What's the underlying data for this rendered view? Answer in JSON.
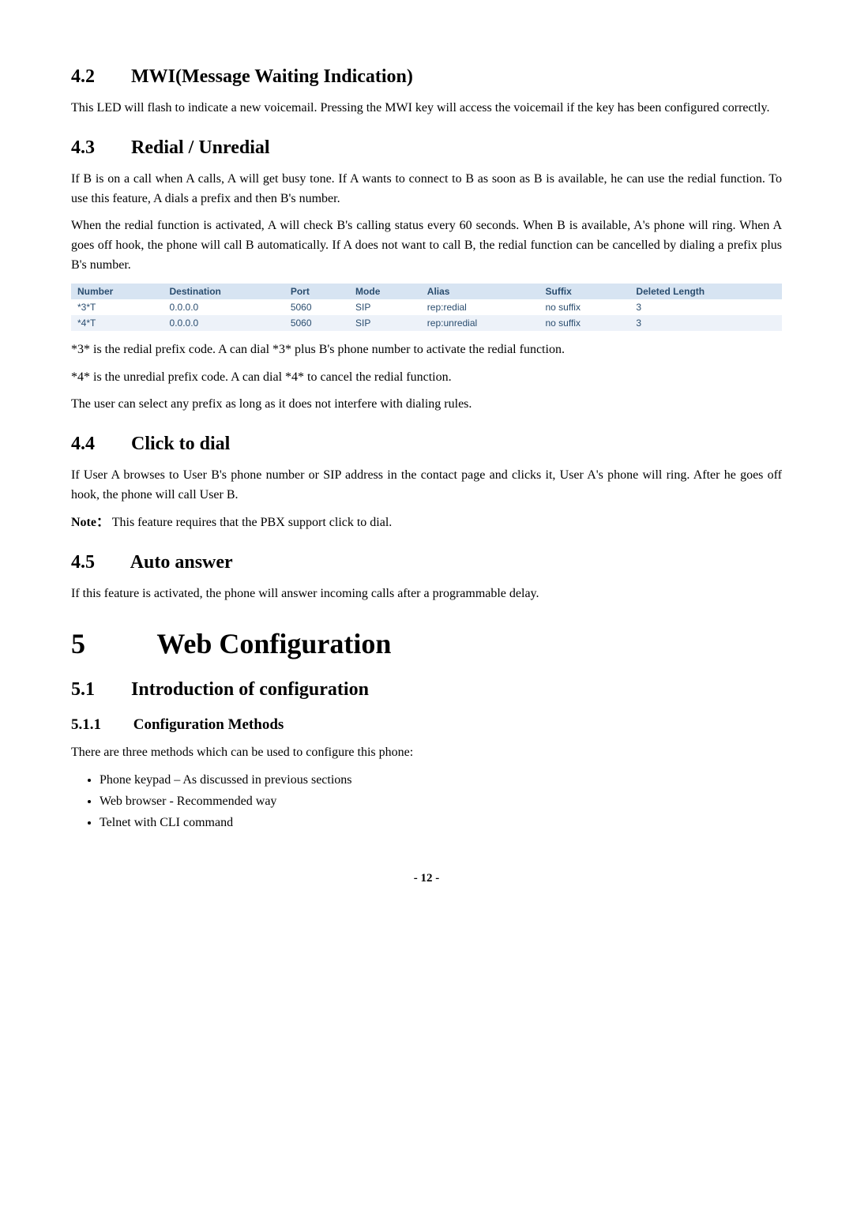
{
  "s42": {
    "num": "4.2",
    "title": "MWI(Message Waiting Indication)",
    "p1": "This LED will flash to indicate a new voicemail.    Pressing the MWI key will access the voicemail if the key has been configured correctly."
  },
  "s43": {
    "num": "4.3",
    "title": "Redial / Unredial",
    "p1": "If B is on a call when A calls, A will get busy tone.   If A wants to connect to B as soon as B is available, he can use the redial function.   To use this feature, A dials a prefix and then B's number.",
    "p2": "When the redial function is activated, A will check B's calling status every 60 seconds. When B is available, A's phone will ring.   When A goes off hook, the phone will call B automatically.    If A does not want to call B, the redial function can be cancelled by dialing a prefix plus B's number.",
    "table": {
      "headers": [
        "Number",
        "Destination",
        "Port",
        "Mode",
        "Alias",
        "Suffix",
        "Deleted Length"
      ],
      "rows": [
        [
          "*3*T",
          "0.0.0.0",
          "5060",
          "SIP",
          "rep:redial",
          "no suffix",
          "3"
        ],
        [
          "*4*T",
          "0.0.0.0",
          "5060",
          "SIP",
          "rep:unredial",
          "no suffix",
          "3"
        ]
      ]
    },
    "p3": "*3* is the redial prefix code.    A can dial *3* plus B's phone number to activate the redial function.",
    "p4": "*4* is the unredial prefix code.    A can dial *4* to cancel the redial function.",
    "p5": "The user can select any prefix as long as it does not interfere with dialing rules."
  },
  "s44": {
    "num": "4.4",
    "title": "Click to dial",
    "p1": "If User A browses to User B's phone number or SIP address in the contact page and clicks it, User A's phone will ring.    After he goes off hook, the phone will call User B.",
    "note_label": "Note：",
    "note_text": "This feature requires that the PBX support click to dial."
  },
  "s45": {
    "num": "4.5",
    "title": "Auto answer",
    "p1": "If this feature is activated, the phone will answer incoming calls after a programmable delay."
  },
  "ch5": {
    "num": "5",
    "title": "Web Configuration"
  },
  "s51": {
    "num": "5.1",
    "title": "Introduction of configuration"
  },
  "s511": {
    "num": "5.1.1",
    "title": "Configuration Methods",
    "p1": "There are three methods which can be used to configure this phone:",
    "items": [
      "Phone keypad – As discussed in previous sections",
      "Web browser - Recommended way",
      "Telnet with CLI command"
    ]
  },
  "page_number": "- 12 -"
}
